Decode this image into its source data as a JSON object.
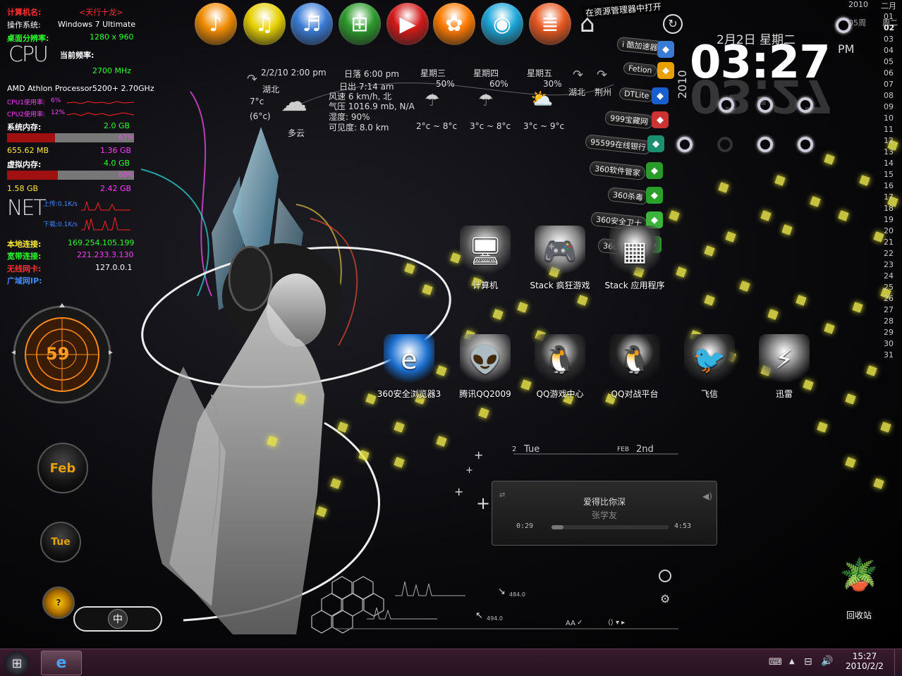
{
  "sysmon": {
    "computer_name_label": "计算机名:",
    "computer_name_value": "<天行十龙>",
    "os_label": "操作系统:",
    "os_value": "Windows 7 Ultimate",
    "resolution_label": "桌面分辨率:",
    "resolution_value": "1280 x 960",
    "cpu_big": "CPU",
    "freq_label": "当前频率:",
    "freq_value": "2700 MHz",
    "processor": "AMD Athlon Processor5200+ 2.70GHz",
    "cpu1_label": "CPU1使用率:",
    "cpu1_value": "6%",
    "cpu2_label": "CPU2使用率:",
    "cpu2_value": "12%",
    "mem_label": "系统内存:",
    "mem_total": "2.0 GB",
    "mem_pct": "67%",
    "mem_used": "655.62 MB",
    "mem_free": "1.36 GB",
    "vmem_label": "虚拟内存:",
    "vmem_total": "4.0 GB",
    "vmem_pct": "60%",
    "vmem_used": "1.58 GB",
    "vmem_free": "2.42 GB",
    "net_big": "NET",
    "upload": "上传:0.1K/s",
    "download": "下载:0.1K/s",
    "local_label": "本地连接:",
    "local_ip": "169.254.105.199",
    "broadband_label": "宽带连接:",
    "broadband_ip": "221.233.3.130",
    "wireless_label": "无线网卡:",
    "wireless_ip": "127.0.0.1",
    "wan_label": "广域网IP:"
  },
  "dock": [
    {
      "name": "foobar-icon",
      "color": "#f08a00",
      "glyph": "♪"
    },
    {
      "name": "music-note-icon",
      "color": "#e8d000",
      "glyph": "♫"
    },
    {
      "name": "itunes-icon",
      "color": "#3a7bd5",
      "glyph": "♬"
    },
    {
      "name": "windows-icon",
      "color": "#2b9b2b",
      "glyph": "⊞"
    },
    {
      "name": "player-icon",
      "color": "#d21818",
      "glyph": "▶"
    },
    {
      "name": "fish-icon",
      "color": "#ff7a00",
      "glyph": "✿"
    },
    {
      "name": "webcam-icon",
      "color": "#1ba6d8",
      "glyph": "◉"
    },
    {
      "name": "notes-icon",
      "color": "#e85820",
      "glyph": "≣"
    }
  ],
  "dock_tooltip": "在资源管理器中打开",
  "weather": {
    "datetime": "2/2/10 2:00 pm",
    "sunset": "日落 6:00 pm",
    "city": "湖北",
    "temp": "7°c",
    "feels": "(6°c)",
    "condition": "多云",
    "sunrise": "日出 7:14 am",
    "wind": "风速 6 km/h, 北",
    "pressure": "气压 1016.9 mb, N/A",
    "humidity": "湿度: 90%",
    "visibility": "可见度: 8.0 km",
    "days": [
      {
        "day": "星期三",
        "pct": "50%",
        "range": "2°c ~ 8°c"
      },
      {
        "day": "星期四",
        "pct": "60%",
        "range": "3°c ~ 8°c"
      },
      {
        "day": "星期五",
        "pct": "30%",
        "range": "3°c ~ 9°c"
      }
    ],
    "nav_city1": "湖北",
    "nav_city2": "荆州"
  },
  "shortcuts": [
    {
      "label": "i 酷加速器",
      "color": "#3a7bd5"
    },
    {
      "label": "Fetion",
      "color": "#e8a000"
    },
    {
      "label": "DTLite",
      "color": "#1a5fd0"
    },
    {
      "label": "999宝藏网",
      "color": "#c33"
    },
    {
      "label": "95599在线银行",
      "color": "#1a9070"
    },
    {
      "label": "360软件管家",
      "color": "#2a9a2a"
    },
    {
      "label": "360杀毒",
      "color": "#2aa02a"
    },
    {
      "label": "360安全卫士",
      "color": "#3cb43c"
    },
    {
      "label": "360保险箱",
      "color": "#2a9a2a"
    }
  ],
  "clock": {
    "date": "2月2日  星期二",
    "time": "03:27",
    "ampm": "PM",
    "year_vertical": "2010"
  },
  "calendar": {
    "year": "2010",
    "month": "二月",
    "week": "05周",
    "weekday": "周二",
    "days": [
      "01",
      "02",
      "03",
      "04",
      "05",
      "06",
      "07",
      "08",
      "09",
      "10",
      "11",
      "12",
      "13",
      "14",
      "15",
      "16",
      "17",
      "18",
      "19",
      "20",
      "21",
      "22",
      "23",
      "24",
      "25",
      "26",
      "27",
      "28",
      "29",
      "30",
      "31"
    ]
  },
  "desktop_icons": [
    {
      "label": "计算机",
      "glyph": "🖥",
      "color": "#555"
    },
    {
      "label": "Stack 疯狂游戏",
      "glyph": "🎮",
      "color": "#888"
    },
    {
      "label": "Stack 应用程序",
      "glyph": "▦",
      "color": "#444"
    },
    {
      "label": "360安全浏览器3",
      "glyph": "e",
      "color": "#1a6fd0"
    },
    {
      "label": "腾讯QQ2009",
      "glyph": "👽",
      "color": "#777"
    },
    {
      "label": "QQ游戏中心",
      "glyph": "🐧",
      "color": "#333"
    },
    {
      "label": "QQ对战平台",
      "glyph": "🐧",
      "color": "#222"
    },
    {
      "label": "飞信",
      "glyph": "🐦",
      "color": "#333"
    },
    {
      "label": "迅雷",
      "glyph": "⚡",
      "color": "#666"
    }
  ],
  "mini_cal": {
    "day_num": "2",
    "day_name": "Tue",
    "month": "FEB",
    "date": "2nd"
  },
  "player": {
    "song": "爱得比你深",
    "artist": "张学友",
    "elapsed": "0:29",
    "total": "4:53",
    "progress": 0.1
  },
  "visualizer": {
    "val1": "484.0",
    "val2": "494.0",
    "font_label": "AA"
  },
  "left_widgets": {
    "radar_value": "59",
    "month": "Feb",
    "weekday": "Tue",
    "orb3": "?",
    "ime": "中"
  },
  "recycle_bin": "回收站",
  "taskbar": {
    "time": "15:27",
    "date": "2010/2/2"
  }
}
